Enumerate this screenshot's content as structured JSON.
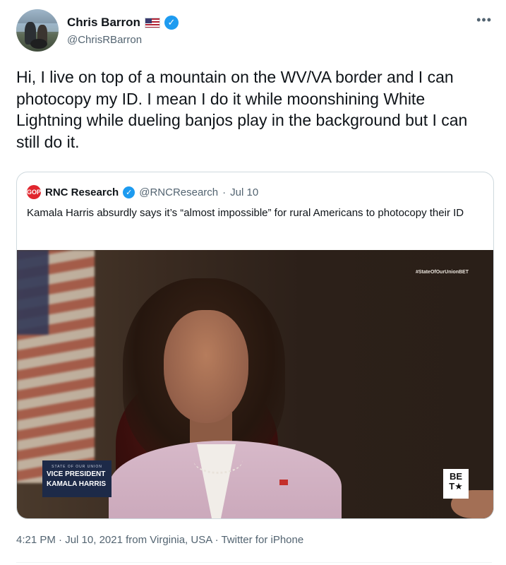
{
  "author": {
    "display_name": "Chris Barron",
    "handle": "@ChrisRBarron",
    "flag_icon": "us-flag",
    "verified_icon": "verified-badge"
  },
  "more_label": "•••",
  "tweet_text": "Hi, I live on top of a mountain on the WV/VA border and I can photocopy my ID. I mean I do it while moonshining White Lightning while dueling banjos play in the background but I can still do it.",
  "quote": {
    "avatar_label": "GOP",
    "display_name": "RNC Research",
    "handle": "@RNCResearch",
    "separator": "·",
    "date": "Jul 10",
    "text": "Kamala Harris absurdly says it’s “almost impossible” for rural Americans to photocopy their ID",
    "media": {
      "hashtag": "#StateOfOurUnionBET",
      "lower_third_small": "STATE OF OUR UNION",
      "lower_third_line1": "VICE PRESIDENT",
      "lower_third_line2": "KAMALA HARRIS",
      "logo_line1": "BE",
      "logo_line2": "T★"
    }
  },
  "footer": {
    "time": "4:21 PM",
    "sep1": " · ",
    "date": "Jul 10, 2021",
    "from": " from ",
    "location": "Virginia, USA",
    "sep2": " · ",
    "source": "Twitter for iPhone"
  },
  "colors": {
    "text_primary": "#0f1419",
    "text_secondary": "#536471",
    "verified": "#1d9bf0",
    "border": "#cfd9de"
  }
}
